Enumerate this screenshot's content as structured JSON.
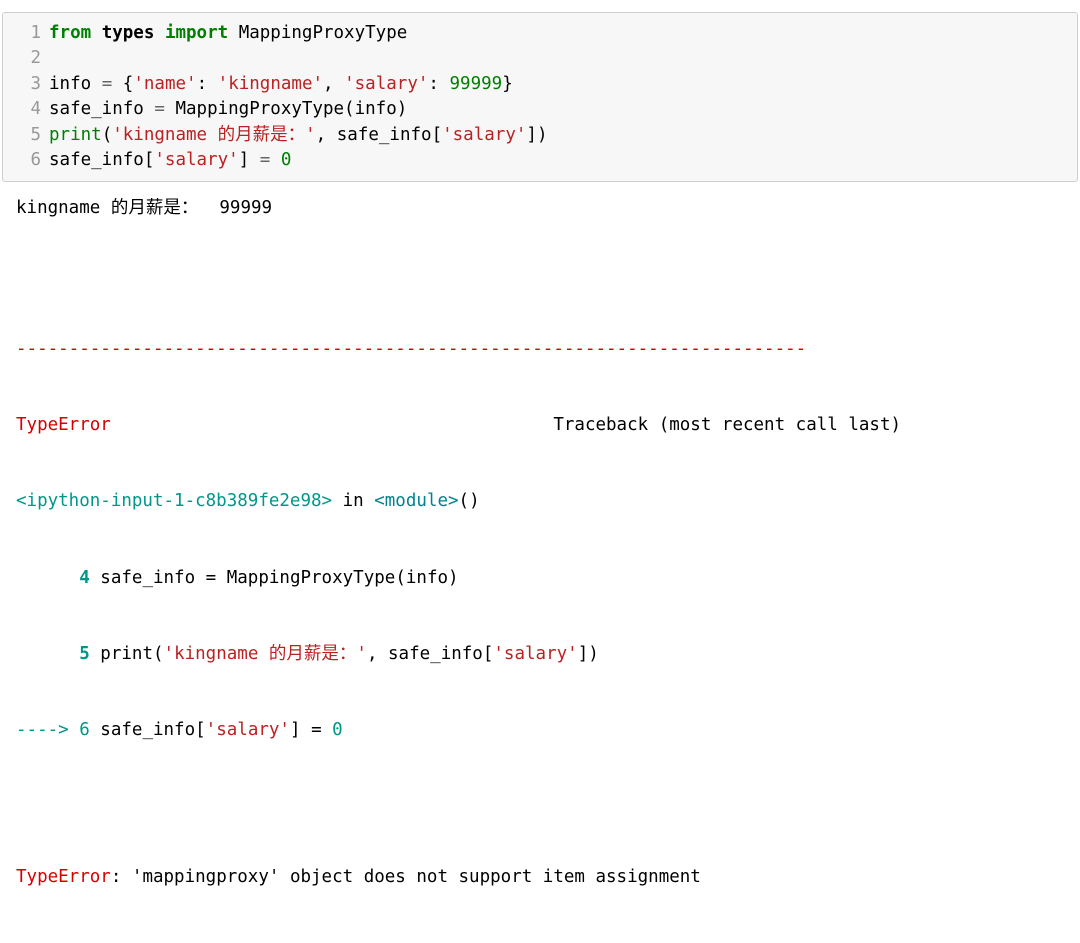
{
  "code": {
    "lines": [
      {
        "n": "1",
        "tokens": [
          [
            "kw",
            "from"
          ],
          [
            "sp",
            " "
          ],
          [
            "nn",
            "types"
          ],
          [
            "sp",
            " "
          ],
          [
            "kw",
            "import"
          ],
          [
            "sp",
            " "
          ],
          [
            "name",
            "MappingProxyType"
          ]
        ]
      },
      {
        "n": "2",
        "tokens": []
      },
      {
        "n": "3",
        "tokens": [
          [
            "name",
            "info"
          ],
          [
            "sp",
            " "
          ],
          [
            "op",
            "="
          ],
          [
            "sp",
            " "
          ],
          [
            "punc",
            "{"
          ],
          [
            "str",
            "'name'"
          ],
          [
            "punc",
            ":"
          ],
          [
            "sp",
            " "
          ],
          [
            "str",
            "'kingname'"
          ],
          [
            "punc",
            ","
          ],
          [
            "sp",
            " "
          ],
          [
            "str",
            "'salary'"
          ],
          [
            "punc",
            ":"
          ],
          [
            "sp",
            " "
          ],
          [
            "num",
            "99999"
          ],
          [
            "punc",
            "}"
          ]
        ]
      },
      {
        "n": "4",
        "tokens": [
          [
            "name",
            "safe_info"
          ],
          [
            "sp",
            " "
          ],
          [
            "op",
            "="
          ],
          [
            "sp",
            " "
          ],
          [
            "name",
            "MappingProxyType"
          ],
          [
            "punc",
            "("
          ],
          [
            "name",
            "info"
          ],
          [
            "punc",
            ")"
          ]
        ]
      },
      {
        "n": "5",
        "tokens": [
          [
            "builtin",
            "print"
          ],
          [
            "punc",
            "("
          ],
          [
            "str",
            "'kingname 的月薪是：'"
          ],
          [
            "punc",
            ","
          ],
          [
            "sp",
            " "
          ],
          [
            "name",
            "safe_info"
          ],
          [
            "punc",
            "["
          ],
          [
            "str",
            "'salary'"
          ],
          [
            "punc",
            "]"
          ],
          [
            "punc",
            ")"
          ]
        ]
      },
      {
        "n": "6",
        "tokens": [
          [
            "name",
            "safe_info"
          ],
          [
            "punc",
            "["
          ],
          [
            "str",
            "'salary'"
          ],
          [
            "punc",
            "]"
          ],
          [
            "sp",
            " "
          ],
          [
            "op",
            "="
          ],
          [
            "sp",
            " "
          ],
          [
            "num",
            "0"
          ]
        ]
      }
    ]
  },
  "stdout": "kingname 的月薪是：  99999",
  "separator": "---------------------------------------------------------------------------",
  "traceback": {
    "error_name": "TypeError",
    "header_right": "Traceback (most recent call last)",
    "frame_file": "<ipython-input-1-c8b389fe2e98>",
    "frame_in": " in ",
    "frame_func": "<module>",
    "frame_paren": "()",
    "context4_prefix": "      4 ",
    "context4_code_tokens": [
      [
        "name",
        "safe_info "
      ],
      [
        "op",
        "="
      ],
      [
        "name",
        " MappingProxyType"
      ],
      [
        "punc",
        "("
      ],
      [
        "name",
        "info"
      ],
      [
        "punc",
        ")"
      ]
    ],
    "context5_prefix": "      5 ",
    "context5_code_tokens": [
      [
        "name",
        "print"
      ],
      [
        "punc",
        "("
      ],
      [
        "str",
        "'kingname 的月薪是：'"
      ],
      [
        "punc",
        ","
      ],
      [
        "name",
        " safe_info"
      ],
      [
        "punc",
        "["
      ],
      [
        "str",
        "'salary'"
      ],
      [
        "punc",
        "]"
      ],
      [
        "punc",
        ")"
      ]
    ],
    "arrow6_prefix": "----> 6 ",
    "arrow6_code_tokens": [
      [
        "name",
        "safe_info"
      ],
      [
        "punc",
        "["
      ],
      [
        "str",
        "'salary'"
      ],
      [
        "punc",
        "]"
      ],
      [
        "name",
        " "
      ],
      [
        "op",
        "="
      ],
      [
        "name",
        " "
      ],
      [
        "num",
        "0"
      ]
    ],
    "final_error_name": "TypeError",
    "final_error_sep": ": ",
    "final_error_msg": "'mappingproxy' object does not support item assignment"
  }
}
